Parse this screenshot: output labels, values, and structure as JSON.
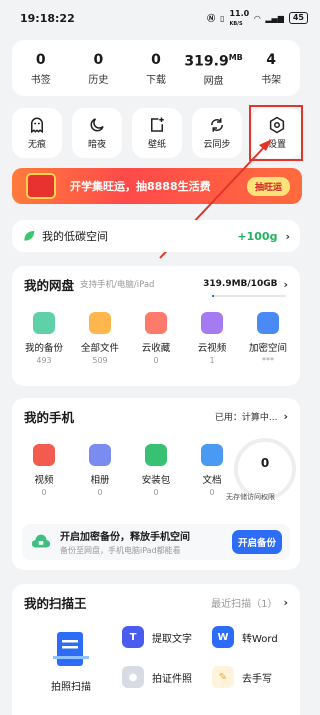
{
  "status_bar": {
    "time": "19:18:22",
    "network_speed": "11.0",
    "speed_unit": "KB/S",
    "battery": "45"
  },
  "stats": [
    {
      "value": "0",
      "label": "书签"
    },
    {
      "value": "0",
      "label": "历史"
    },
    {
      "value": "0",
      "label": "下载"
    },
    {
      "value": "319.9",
      "unit": "MB",
      "label": "网盘"
    },
    {
      "value": "4",
      "label": "书架"
    }
  ],
  "quick_actions": [
    {
      "label": "无痕",
      "icon": "ghost-icon"
    },
    {
      "label": "暗夜",
      "icon": "moon-icon"
    },
    {
      "label": "壁纸",
      "icon": "wallpaper-icon"
    },
    {
      "label": "云同步",
      "icon": "sync-icon"
    },
    {
      "label": "设置",
      "icon": "gear-icon"
    }
  ],
  "banner": {
    "text": "开学集旺运，抽8888生活费",
    "button": "抽旺运"
  },
  "low_carbon": {
    "label": "我的低碳空间",
    "value": "+100g"
  },
  "netdisk": {
    "title": "我的网盘",
    "subtitle": "支持手机/电脑/iPad",
    "storage": "319.9MB/10GB",
    "usage_fraction": 0.03,
    "items": [
      {
        "label": "我的备份",
        "count": "493",
        "color": "#5fd1a8"
      },
      {
        "label": "全部文件",
        "count": "509",
        "color": "#ffb74d"
      },
      {
        "label": "云收藏",
        "count": "0",
        "color": "#ff7a6b"
      },
      {
        "label": "云视频",
        "count": "1",
        "color": "#a47bf0"
      },
      {
        "label": "加密空间",
        "count": "***",
        "color": "#4a8af4"
      }
    ]
  },
  "phone": {
    "title": "我的手机",
    "used": "已用：计算中...",
    "items": [
      {
        "label": "视频",
        "count": "0",
        "color": "#f25b4e"
      },
      {
        "label": "相册",
        "count": "0",
        "color": "#7b8cf0"
      },
      {
        "label": "安装包",
        "count": "0",
        "color": "#38c172"
      },
      {
        "label": "文档",
        "count": "0",
        "color": "#4a9af4"
      }
    ],
    "gauge_value": "0",
    "gauge_label": "无存储访问权限",
    "backup": {
      "title": "开启加密备份，释放手机空间",
      "desc": "备份至网盘，手机电脑iPad都能看",
      "button": "开启备份"
    }
  },
  "scanner": {
    "title": "我的扫描王",
    "recent": "最近扫描（1）",
    "big": "拍照扫描",
    "options": [
      {
        "label": "提取文字",
        "icon": "T",
        "color": "#4a5bf0"
      },
      {
        "label": "转Word",
        "icon": "W",
        "color": "#2c6cf6"
      },
      {
        "label": "拍证件照",
        "icon": "",
        "color": "#3a3a4a"
      },
      {
        "label": "去手写",
        "icon": "",
        "color": "#f5a623"
      }
    ]
  }
}
